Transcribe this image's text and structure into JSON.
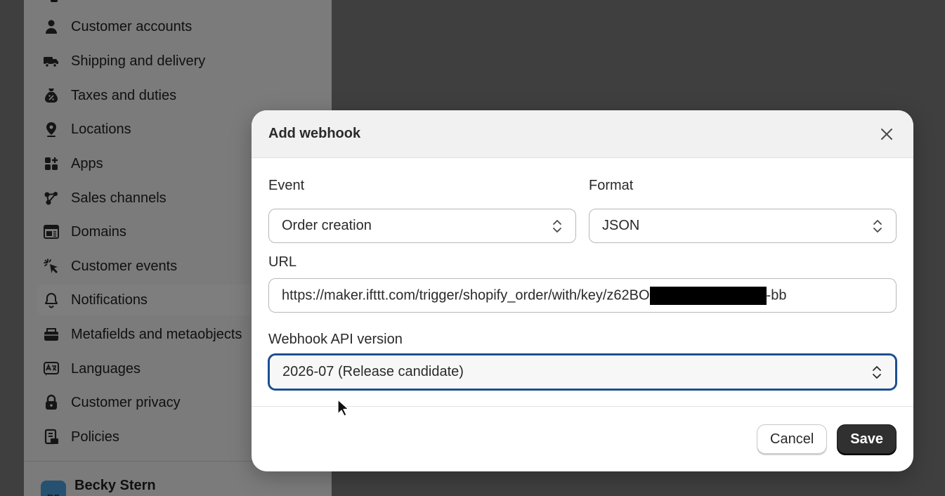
{
  "sidebar": {
    "items": [
      {
        "label": "Customer accounts",
        "icon": "person-icon"
      },
      {
        "label": "Shipping and delivery",
        "icon": "truck-icon"
      },
      {
        "label": "Taxes and duties",
        "icon": "tax-bag-icon"
      },
      {
        "label": "Locations",
        "icon": "location-pin-icon"
      },
      {
        "label": "Apps",
        "icon": "apps-icon"
      },
      {
        "label": "Sales channels",
        "icon": "sales-channels-icon"
      },
      {
        "label": "Domains",
        "icon": "domains-icon"
      },
      {
        "label": "Customer events",
        "icon": "cursor-click-icon"
      },
      {
        "label": "Notifications",
        "icon": "bell-icon",
        "active": true
      },
      {
        "label": "Metafields and metaobjects",
        "icon": "metafields-icon"
      },
      {
        "label": "Languages",
        "icon": "language-icon"
      },
      {
        "label": "Customer privacy",
        "icon": "lock-icon"
      },
      {
        "label": "Policies",
        "icon": "policies-icon"
      }
    ],
    "user": {
      "initials": "BS",
      "name": "Becky Stern"
    }
  },
  "modal": {
    "title": "Add webhook",
    "event_label": "Event",
    "event_value": "Order creation",
    "format_label": "Format",
    "format_value": "JSON",
    "url_label": "URL",
    "url_prefix": "https://maker.ifttt.com/trigger/shopify_order/with/key/z62BO",
    "url_suffix": "-bb",
    "api_label": "Webhook API version",
    "api_value": "2026-07 (Release candidate)",
    "cancel_label": "Cancel",
    "save_label": "Save"
  },
  "colors": {
    "primary_button": "#303030",
    "focus_ring": "#1d4f91",
    "avatar": "#4a9bd6"
  }
}
